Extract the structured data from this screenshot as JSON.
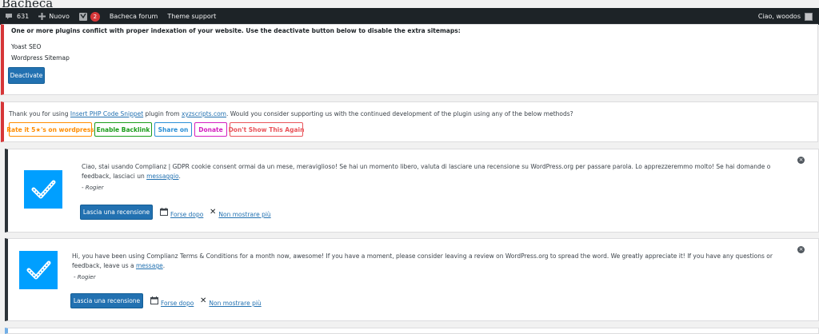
{
  "page": {
    "heading": "Bacheca"
  },
  "adminbar": {
    "comments_count": "631",
    "new_label": "Nuovo",
    "yoast_badge": "2",
    "forum_label": "Bacheca forum",
    "theme_support_label": "Theme support",
    "greeting": "Ciao, woodos"
  },
  "conflict_notice": {
    "message": "One or more plugins conflict with proper indexation of your website. Use the deactivate button below to disable the extra sitemaps:",
    "plugins": [
      "Yoast SEO",
      "Wordpress Sitemap"
    ],
    "deactivate_label": "Deactivate"
  },
  "xyz_notice": {
    "text_before": "Thank you for using ",
    "plugin_link": "Insert PHP Code Snippet",
    "text_middle": " plugin from ",
    "site_link": "xyzscripts.com",
    "text_after": ". Would you consider supporting us with the continued development of the plugin using any of the below methods?",
    "buttons": [
      {
        "label": "Rate it 5★'s on wordpress",
        "color": "#ff8c00"
      },
      {
        "label": "Enable Backlink",
        "color": "#1a9c1a"
      },
      {
        "label": "Share on",
        "color": "#2a8fd6"
      },
      {
        "label": "Donate",
        "color": "#d41fc0"
      },
      {
        "label": "Don't Show This Again",
        "color": "#e9545a"
      }
    ]
  },
  "cmplz_gdpr": {
    "text": "Ciao, stai usando Complianz | GDPR cookie consent ormai da un mese, meraviglioso! Se hai un momento libero, valuta di lasciare una recensione su WordPress.org per passare parola. Lo apprezzeremmo molto! Se hai domande o feedback, lasciaci un ",
    "link": "messaggio",
    "text_end": ".",
    "signature": "- Rogier",
    "review_label": "Lascia una recensione",
    "later_label": "Forse dopo",
    "never_label": "Non mostrare più"
  },
  "cmplz_terms": {
    "text": "Hi, you have been using Complianz Terms & Conditions for a month now, awesome! If you have a moment, please consider leaving a review on WordPress.org to spread the word. We greatly appreciate it! If you have any questions or feedback, leave us a ",
    "link": "message",
    "text_end": ".",
    "signature": "- Rogier",
    "review_label": "Lascia una recensione",
    "later_label": "Forse dopo",
    "never_label": "Non mostrare più"
  },
  "colors": {
    "adminbar": "#1d2327",
    "primary": "#2271b1",
    "error_border": "#d63638",
    "complianz_blue": "#009fff"
  }
}
